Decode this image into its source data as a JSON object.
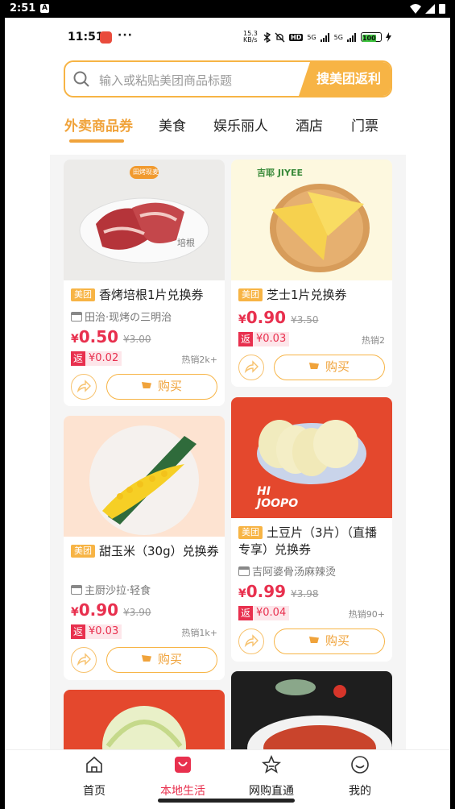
{
  "system_bar": {
    "time": "2:51",
    "notif": "A"
  },
  "inner_status": {
    "time": "11:51",
    "dots": "···",
    "net_speed": "15.3 KB/s",
    "hd": "HD",
    "sig1": "5G",
    "sig2": "5G",
    "battery": "100"
  },
  "search": {
    "placeholder": "输入或粘贴美团商品标题",
    "button": "搜美团返利"
  },
  "tabs": [
    "外卖商品券",
    "美食",
    "娱乐丽人",
    "酒店",
    "门票"
  ],
  "colors": {
    "accent": "#f7b445",
    "price": "#e8304e"
  },
  "cards": [
    {
      "badge": "美团",
      "title": "香烤培根1片兑换券",
      "shop": "田治·现烤の三明治",
      "cur": "¥",
      "price": "0.50",
      "orig": "¥3.00",
      "rebate_tag": "返",
      "rebate": "¥0.02",
      "sold": "热销2k+",
      "buy": "购买",
      "img_label": "培根",
      "img_logo": "田烤现麦"
    },
    {
      "badge": "美团",
      "title": "芝士1片兑换券",
      "shop": "",
      "cur": "¥",
      "price": "0.90",
      "orig": "¥3.50",
      "rebate_tag": "返",
      "rebate": "¥0.03",
      "sold": "热销2",
      "buy": "购买",
      "img_logo": "吉耶 JIYEE"
    },
    {
      "badge": "美团",
      "title": "甜玉米（30g）兑换券",
      "shop": "主厨沙拉·轻食",
      "cur": "¥",
      "price": "0.90",
      "orig": "¥3.90",
      "rebate_tag": "返",
      "rebate": "¥0.03",
      "sold": "热销1k+",
      "buy": "购买"
    },
    {
      "badge": "美团",
      "title": "土豆片（3片）（直播专享）兑换券",
      "shop": "吉阿婆骨汤麻辣烫",
      "cur": "¥",
      "price": "0.99",
      "orig": "¥3.98",
      "rebate_tag": "返",
      "rebate": "¥0.04",
      "sold": "热销90+",
      "buy": "购买",
      "img_logo": "HI JOOPO"
    }
  ],
  "bottom_nav": [
    {
      "label": "首页",
      "icon": "home-icon"
    },
    {
      "label": "本地生活",
      "icon": "bag-icon"
    },
    {
      "label": "网购直通",
      "icon": "star-icon"
    },
    {
      "label": "我的",
      "icon": "smile-icon"
    }
  ]
}
